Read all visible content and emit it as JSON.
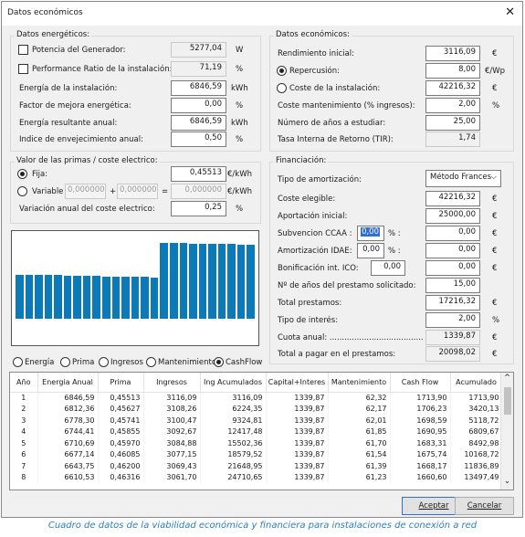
{
  "window": {
    "title": "Datos económicos",
    "close": "✕"
  },
  "energy": {
    "legend": "Datos energéticos:",
    "potencia_label": "Potencia del Generador:",
    "potencia_value": "5277,04",
    "potencia_unit": "W",
    "pr_label": "Performance Ratio de la instalación:",
    "pr_value": "71,19",
    "pr_unit": "%",
    "energia_label": "Energía de la instalación:",
    "energia_value": "6846,59",
    "energia_unit": "kWh",
    "factor_label": "Factor de mejora energética:",
    "factor_value": "0,00",
    "factor_unit": "%",
    "resultante_label": "Energía resultante anual:",
    "resultante_value": "6846,59",
    "resultante_unit": "kWh",
    "envej_label": "Indice de envejecimiento anual:",
    "envej_value": "0,50",
    "envej_unit": "%"
  },
  "primas": {
    "legend": "Valor de las primas / coste electrico:",
    "fija_label": "Fija:",
    "fija_value": "0,45513",
    "fija_unit": "€/kWh",
    "variable_label": "Variable",
    "var1": "0,000000",
    "plus": "+",
    "var2": "0,000000",
    "eq": "=",
    "var3": "0,000000",
    "var_unit": "€/kWh",
    "variacion_label": "Variación anual del coste electrico:",
    "variacion_value": "0,25",
    "variacion_unit": "%"
  },
  "econ": {
    "legend": "Datos económicos:",
    "rend_label": "Rendimiento inicial:",
    "rend_value": "3116,09",
    "rend_unit": "€",
    "repercusion_label": "Repercusión:",
    "repercusion_value": "8,00",
    "repercusion_unit": "€/Wp",
    "coste_label": "Coste de la instalación:",
    "coste_value": "42216,32",
    "coste_unit": "€",
    "mant_label": "Coste mantenimiento (% ingresos):",
    "mant_value": "2,00",
    "mant_unit": "%",
    "anios_label": "Número de años a estudiar:",
    "anios_value": "25,00",
    "tir_label": "Tasa Interna de Retorno (TIR):",
    "tir_value": "1,74"
  },
  "fin": {
    "legend": "Financiación:",
    "tipo_label": "Tipo de amortización:",
    "tipo_value": "Método Frances",
    "tipo_chev": "⌵",
    "elegible_label": "Coste elegible:",
    "elegible_value": "42216,32",
    "elegible_unit": "€",
    "aportacion_label": "Aportación inicial:",
    "aportacion_value": "25000,00",
    "aportacion_unit": "€",
    "ccaa_label": "Subvencion CCAA :",
    "ccaa_pct": "0,00",
    "ccaa_pct_unit": "% :",
    "ccaa_value": "0,00",
    "ccaa_unit": "€",
    "idae_label": "Amortización IDAE:",
    "idae_pct": "0,00",
    "idae_pct_unit": "% :",
    "idae_value": "0,00",
    "idae_unit": "€",
    "ico_label": "Bonificación int. ICO:",
    "ico_pct": "0,00",
    "ico_value": "0,00",
    "ico_unit": "€",
    "anios_label": "Nº de años del prestamo solicitado:",
    "anios_value": "15,00",
    "total_label": "Total prestamos:",
    "total_value": "17216,32",
    "total_unit": "€",
    "interes_label": "Tipo de interés:",
    "interes_value": "2,00",
    "interes_unit": "%",
    "cuota_label": "Cuota anual: ......................................",
    "cuota_value": "1339,87",
    "cuota_unit": "€",
    "pagar_label": "Total a pagar en el prestamos:",
    "pagar_value": "20098,02",
    "pagar_unit": "€"
  },
  "chart_data": {
    "type": "bar",
    "selected_series": "CashFlow",
    "values": [
      1713.9,
      1706.23,
      1698.59,
      1690.95,
      1683.31,
      1675.74,
      1668.17,
      1660.6,
      1653.1,
      1645.6,
      1638.1,
      1630.7,
      1623.3,
      1615.9,
      1608.5,
      2940.8,
      2933.5,
      2926.2,
      2918.9,
      2911.6,
      2904.4,
      2897.2,
      2890.0,
      2882.8,
      2875.6
    ],
    "ylim": [
      0,
      3400
    ]
  },
  "radios": {
    "energia": "Energía",
    "prima": "Prima",
    "ingresos": "Ingresos",
    "mantenimiento": "Mantenimiento",
    "cashflow": "CashFlow"
  },
  "table": {
    "headers": [
      "Año",
      "Energia Anual",
      "Prima",
      "Ingresos",
      "Ing Acumulados",
      "Capital+Interes",
      "Mantenimiento",
      "Cash Flow",
      "Acumulado"
    ],
    "rows": [
      [
        "1",
        "6846,59",
        "0,45513",
        "3116,09",
        "3116,09",
        "1339,87",
        "62,32",
        "1713,90",
        "1713,90"
      ],
      [
        "2",
        "6812,36",
        "0,45627",
        "3108,26",
        "6224,35",
        "1339,87",
        "62,17",
        "1706,23",
        "3420,13"
      ],
      [
        "3",
        "6778,30",
        "0,45741",
        "3100,47",
        "9324,81",
        "1339,87",
        "62,01",
        "1698,59",
        "5118,72"
      ],
      [
        "4",
        "6744,41",
        "0,45855",
        "3092,67",
        "12417,48",
        "1339,87",
        "61,85",
        "1690,95",
        "6809,67"
      ],
      [
        "5",
        "6710,69",
        "0,45970",
        "3084,88",
        "15502,36",
        "1339,87",
        "61,70",
        "1683,31",
        "8492,98"
      ],
      [
        "6",
        "6677,14",
        "0,46085",
        "3077,15",
        "18579,52",
        "1339,87",
        "61,54",
        "1675,74",
        "10168,72"
      ],
      [
        "7",
        "6643,75",
        "0,46200",
        "3069,43",
        "21648,95",
        "1339,87",
        "61,39",
        "1668,17",
        "11836,89"
      ],
      [
        "8",
        "6610,53",
        "0,46316",
        "3061,70",
        "24710,65",
        "1339,87",
        "61,23",
        "1660,60",
        "13497,49"
      ]
    ],
    "scroll_up": "^",
    "scroll_down": "⌄"
  },
  "buttons": {
    "accept": "Aceptar",
    "cancel": "Cancelar"
  },
  "caption": "Cuadro de datos de la viabilidad económica y financiera para instalaciones de conexión a red",
  "colors": {
    "bar": "#0c79b8",
    "accent": "#2f6fd6",
    "caption": "#2b7fc4"
  }
}
